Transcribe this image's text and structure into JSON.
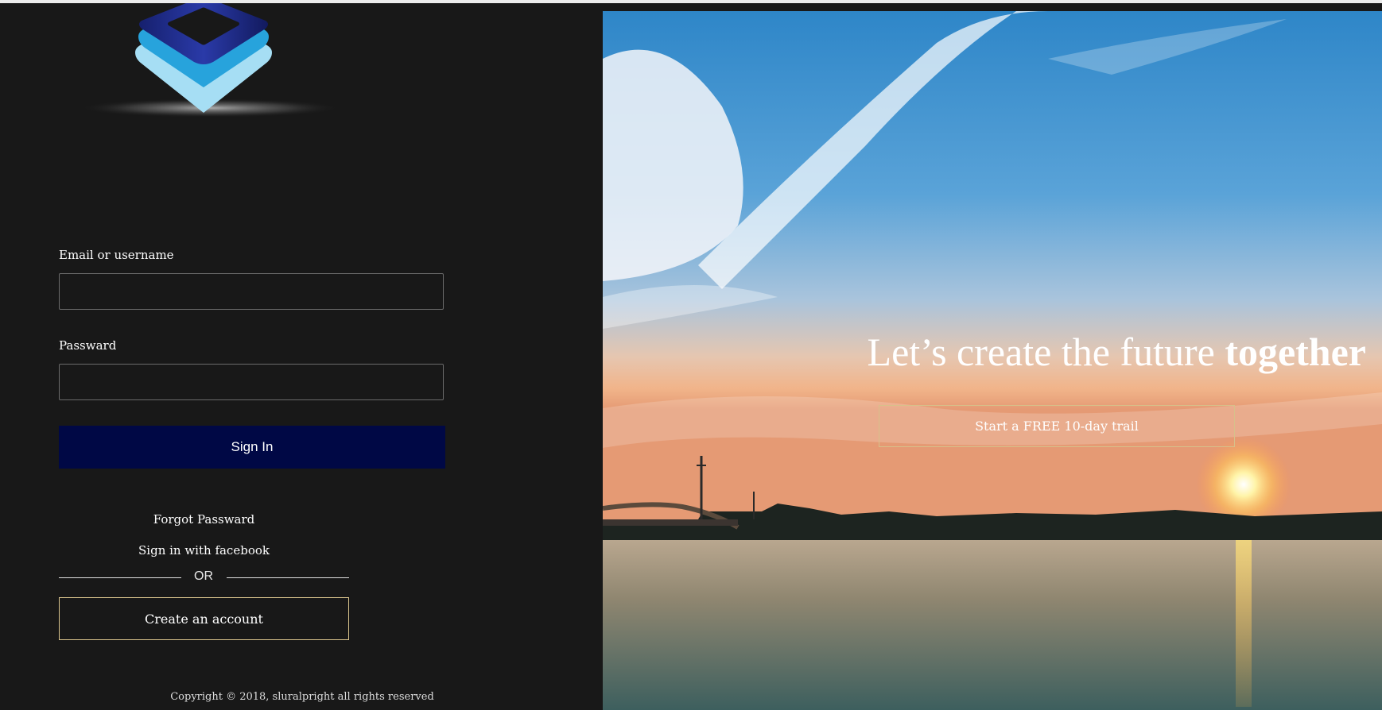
{
  "login": {
    "email_label": "Email or username",
    "email_value": "",
    "password_label": "Passward",
    "password_value": "",
    "sign_in_label": "Sign In",
    "forgot_label": "Forgot Passward",
    "facebook_label": "Sign in with facebook",
    "or_label": "OR",
    "create_account_label": "Create an account"
  },
  "footer": {
    "copyright": "Copyright © 2018, sluralpright all rights reserved"
  },
  "hero": {
    "title_regular": "Let’s create the future ",
    "title_bold": "together",
    "trial_label": "Start a FREE 10-day trail"
  },
  "colors": {
    "background": "#181818",
    "sign_in_button": "#000845",
    "accent_border": "#d9c48d"
  },
  "icons": {
    "logo": "stacked-layers-logo-icon"
  }
}
